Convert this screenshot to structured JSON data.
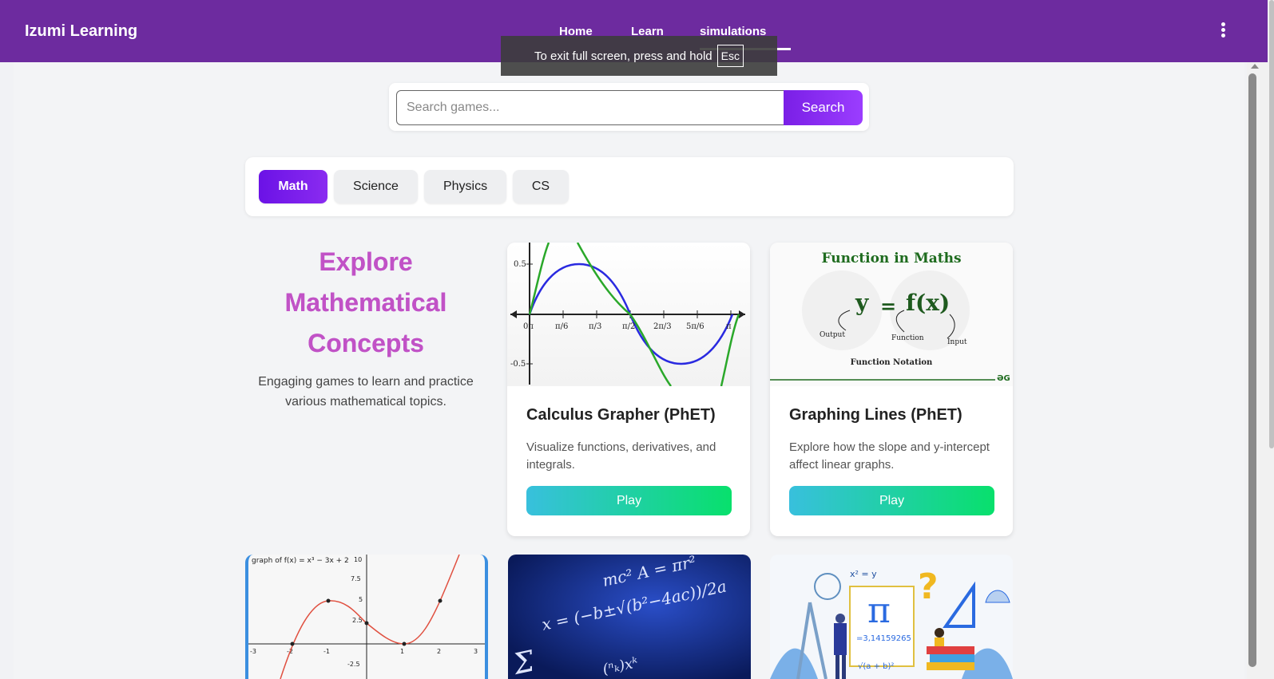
{
  "header": {
    "brand": "Izumi Learning",
    "nav": [
      {
        "label": "Home"
      },
      {
        "label": "Learn"
      },
      {
        "label": "simulations"
      }
    ]
  },
  "fullscreen_toast": {
    "text": "To exit full screen, press and hold",
    "key": "Esc"
  },
  "search": {
    "placeholder": "Search games...",
    "button": "Search"
  },
  "categories": [
    {
      "label": "Math",
      "active": true
    },
    {
      "label": "Science",
      "active": false
    },
    {
      "label": "Physics",
      "active": false
    },
    {
      "label": "CS",
      "active": false
    }
  ],
  "hero": {
    "title_line1": "Explore",
    "title_line2": "Mathematical",
    "title_line3": "Concepts",
    "subtitle": "Engaging games to learn and practice various mathematical topics."
  },
  "cards": [
    {
      "title": "Calculus Grapher (PhET)",
      "description": "Visualize functions, derivatives, and integrals.",
      "button": "Play",
      "image_labels": {
        "y_top": "0.5",
        "y_bottom": "-0.5",
        "ticks": [
          "0π",
          "π/6",
          "π/3",
          "π/2",
          "2π/3",
          "5π/6",
          "π"
        ]
      }
    },
    {
      "title": "Graphing Lines (PhET)",
      "description": "Explore how the slope and y-intercept affect linear graphs.",
      "button": "Play",
      "image_labels": {
        "heading": "Function in Maths",
        "formula_y": "y",
        "formula_eq": "=",
        "formula_fx": "f(x)",
        "output": "Output",
        "function": "Function",
        "input": "Input",
        "notation": "Function Notation"
      }
    }
  ],
  "row2": {
    "graph_caption": "graph of f(x) = x³ − 3x + 2",
    "graph_ticks_y": [
      "10",
      "7.5",
      "5",
      "2.5",
      "-2.5"
    ],
    "graph_ticks_x": [
      "-3",
      "-2",
      "-1",
      "1",
      "2",
      "3"
    ],
    "formula_text": "x = (−b±√(b²−4ac))/2a",
    "formula_text2": "mc²  A = πr²",
    "pi_labels": {
      "xsq": "x² = y",
      "pi": "π",
      "pi_value": "=3,14159265",
      "sqrt": "√(a + b)²"
    }
  },
  "colors": {
    "header": "#6d2b9f",
    "accent": "#7a1fe6",
    "play_gradient_start": "#38c0dd",
    "play_gradient_end": "#08e06c",
    "hero_title": "#c152c6"
  }
}
